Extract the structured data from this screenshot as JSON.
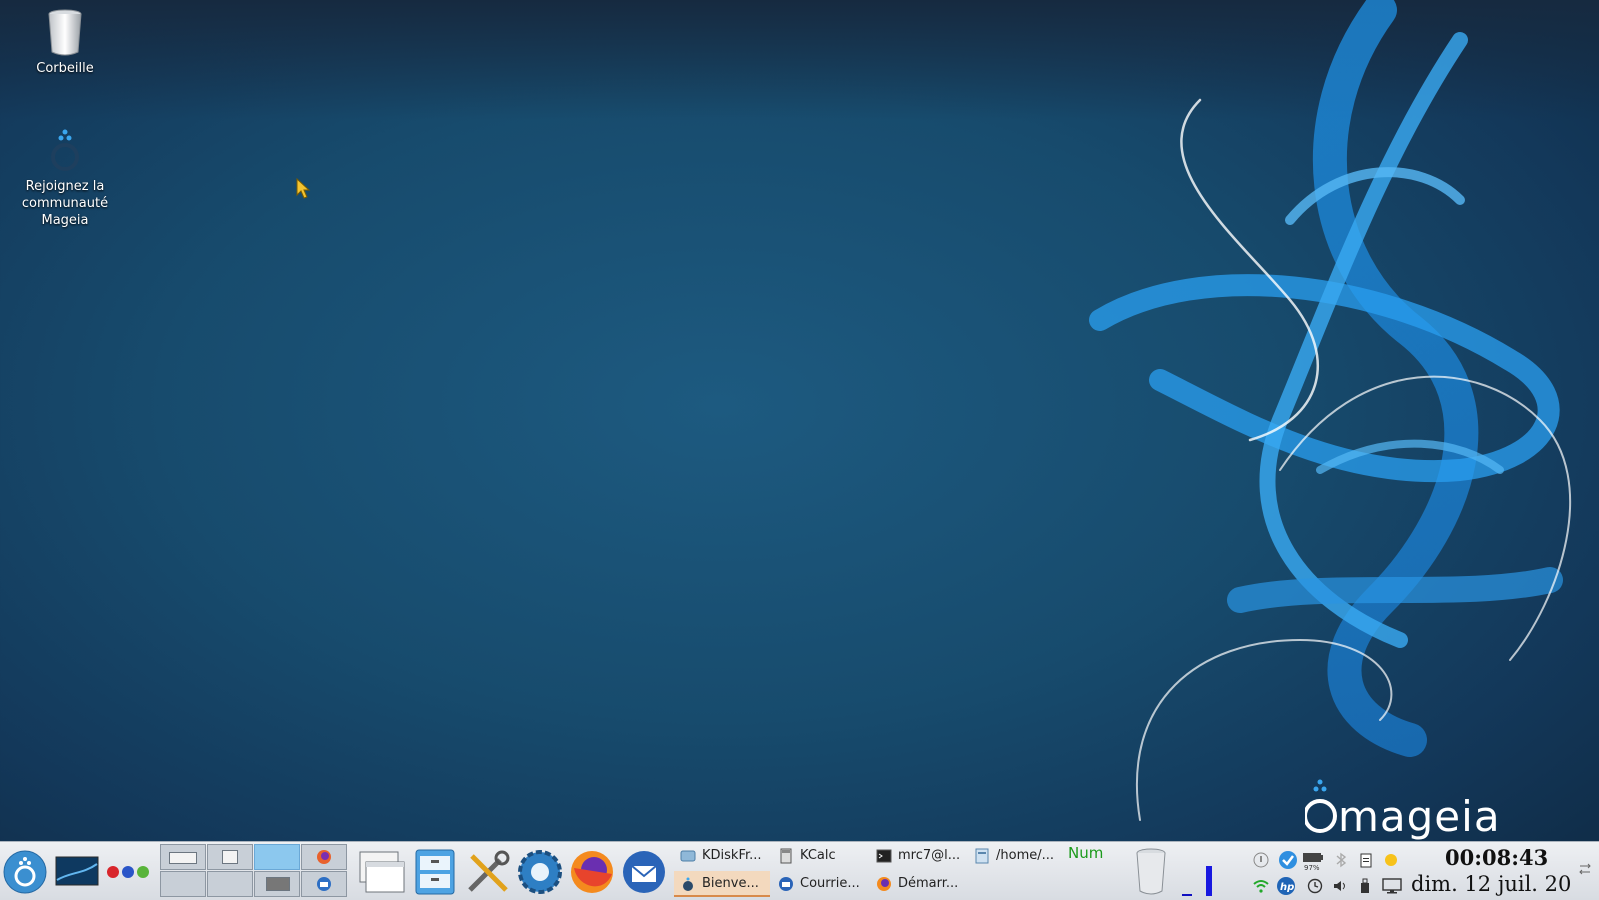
{
  "desktop": {
    "icons": [
      {
        "label": "Corbeille",
        "icon": "trash-icon"
      },
      {
        "label": "Rejoignez la communauté Mageia",
        "icon": "mageia-community-icon"
      }
    ],
    "wallpaper_logo_text": "mageia",
    "colors": {
      "background": "#174b6d",
      "accent": "#2f9ae0"
    }
  },
  "taskbar": {
    "launchers": [
      "mageia-menu-icon",
      "show-desktop-icon",
      "color-dots-icon",
      "window-switcher-icon",
      "file-manager-icon",
      "settings-tools-icon",
      "control-center-icon",
      "firefox-icon",
      "thunderbird-icon"
    ],
    "tasks": [
      {
        "label": "KDiskFr...",
        "icon": "kdiskfree-icon",
        "active": false
      },
      {
        "label": "Bienve...",
        "icon": "mageia-welcome-icon",
        "active": true
      },
      {
        "label": "KCalc",
        "icon": "calculator-icon",
        "active": false
      },
      {
        "label": "Courrie...",
        "icon": "thunderbird-icon",
        "active": false
      },
      {
        "label": "mrc7@l...",
        "icon": "terminal-icon",
        "active": false
      },
      {
        "label": "Démarr...",
        "icon": "firefox-icon",
        "active": false
      },
      {
        "label": "/home/...",
        "icon": "folder-icon",
        "active": false
      }
    ],
    "numlock": "Num",
    "battery_percent": "97%",
    "clock_time": "00:08:43",
    "clock_date": "dim. 12 juil. 20"
  }
}
